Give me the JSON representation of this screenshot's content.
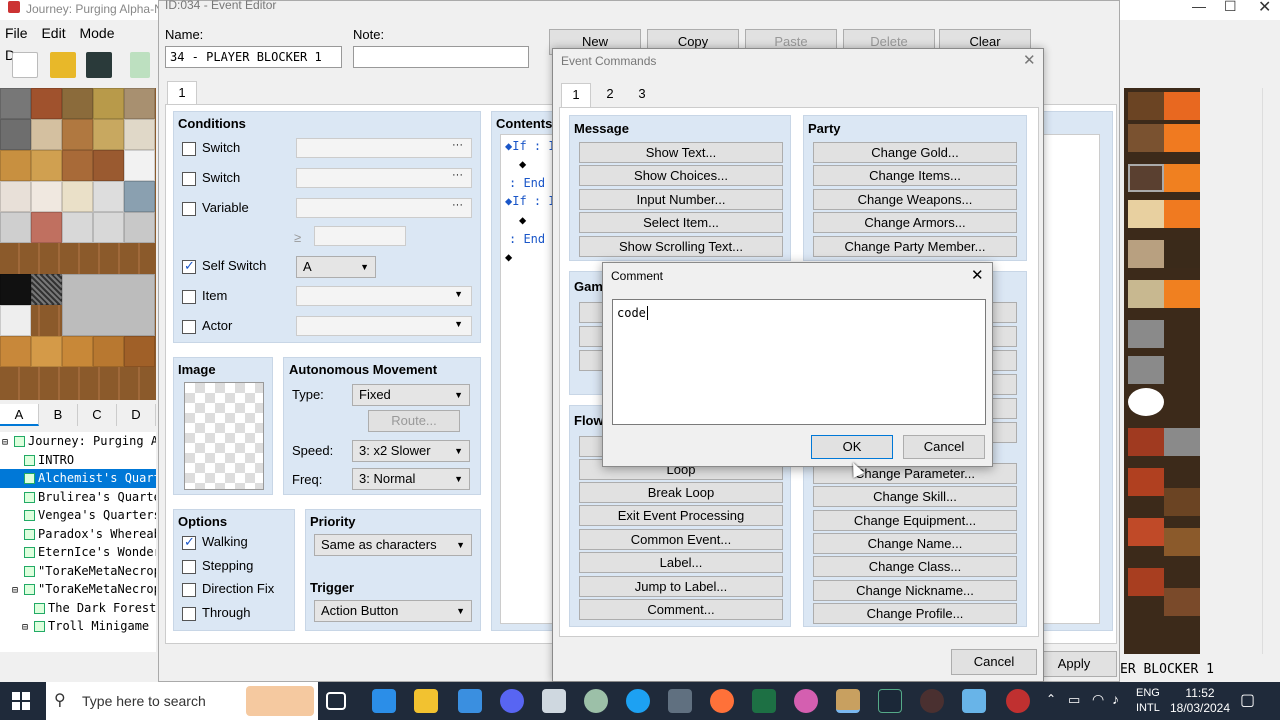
{
  "main": {
    "title": "Journey: Purging Alpha-N",
    "menu": [
      "File",
      "Edit",
      "Mode",
      "Draw"
    ],
    "tile_tabs": [
      "A",
      "B",
      "C",
      "D"
    ],
    "map_tree": [
      {
        "label": "Journey: Purging Al",
        "expand": "⊟",
        "indent": 0,
        "selected": false
      },
      {
        "label": "INTRO",
        "expand": "",
        "indent": 1,
        "selected": false
      },
      {
        "label": "Alchemist's Quarte",
        "expand": "",
        "indent": 1,
        "selected": true
      },
      {
        "label": "Brulirea's Quarter",
        "expand": "",
        "indent": 1,
        "selected": false
      },
      {
        "label": "Vengea's Quarters",
        "expand": "",
        "indent": 1,
        "selected": false
      },
      {
        "label": "Paradox's Whereabo",
        "expand": "",
        "indent": 1,
        "selected": false
      },
      {
        "label": "EternIce's Wonderl",
        "expand": "",
        "indent": 1,
        "selected": false
      },
      {
        "label": "\"ToraKeMetaNecropo",
        "expand": "",
        "indent": 1,
        "selected": false
      },
      {
        "label": "\"ToraKeMetaNecropo",
        "expand": "⊟",
        "indent": 1,
        "selected": false
      },
      {
        "label": "The Dark Forest o",
        "expand": "",
        "indent": 2,
        "selected": false
      },
      {
        "label": "Troll Minigame XE",
        "expand": "⊟",
        "indent": 2,
        "selected": false
      }
    ],
    "map_status": "ER BLOCKER 1"
  },
  "event_editor": {
    "title": "ID:034 - Event Editor",
    "name_label": "Name:",
    "name_value": "34 - PLAYER BLOCKER 1",
    "note_label": "Note:",
    "note_value": "",
    "page_buttons": [
      "New",
      "Copy",
      "Paste",
      "Delete",
      "Clear"
    ],
    "page_tab": "1",
    "conditions": {
      "header": "Conditions",
      "rows": [
        {
          "label": "Switch",
          "checked": false
        },
        {
          "label": "Switch",
          "checked": false
        },
        {
          "label": "Variable",
          "checked": false
        },
        {
          "label": "Self Switch",
          "checked": true
        },
        {
          "label": "Item",
          "checked": false
        },
        {
          "label": "Actor",
          "checked": false
        }
      ],
      "gte_symbol": "≥",
      "self_switch_value": "A"
    },
    "image_header": "Image",
    "autonomous": {
      "header": "Autonomous Movement",
      "type_label": "Type:",
      "type_value": "Fixed",
      "route_label": "Route...",
      "speed_label": "Speed:",
      "speed_value": "3: x2 Slower",
      "freq_label": "Freq:",
      "freq_value": "3: Normal"
    },
    "options": {
      "header": "Options",
      "items": [
        {
          "label": "Walking",
          "checked": true
        },
        {
          "label": "Stepping",
          "checked": false
        },
        {
          "label": "Direction Fix",
          "checked": false
        },
        {
          "label": "Through",
          "checked": false
        }
      ]
    },
    "priority": {
      "header": "Priority",
      "value": "Same as characters"
    },
    "trigger": {
      "header": "Trigger",
      "value": "Action Button"
    },
    "contents": {
      "header": "Contents",
      "lines": [
        "◆If : I",
        "◆",
        ": End",
        "◆If : I",
        "◆",
        ": End",
        "◆"
      ]
    },
    "apply_label": "Apply"
  },
  "event_commands": {
    "title": "Event Commands",
    "tabs": [
      "1",
      "2",
      "3"
    ],
    "message": {
      "header": "Message",
      "buttons": [
        "Show Text...",
        "Show Choices...",
        "Input Number...",
        "Select Item...",
        "Show Scrolling Text..."
      ]
    },
    "party": {
      "header": "Party",
      "buttons": [
        "Change Gold...",
        "Change Items...",
        "Change Weapons...",
        "Change Armors...",
        "Change Party Member..."
      ]
    },
    "game_header": "Gam",
    "flow": {
      "header": "Flow",
      "buttons": [
        "Loop",
        "Break Loop",
        "Exit Event Processing",
        "Common Event...",
        "Label...",
        "Jump to Label...",
        "Comment..."
      ]
    },
    "actor_buttons": [
      "Change Parameter...",
      "Change Skill...",
      "Change Equipment...",
      "Change Name...",
      "Change Class...",
      "Change Nickname...",
      "Change Profile..."
    ],
    "cancel_label": "Cancel"
  },
  "comment_dialog": {
    "title": "Comment",
    "text": "code",
    "ok_label": "OK",
    "cancel_label": "Cancel"
  },
  "taskbar": {
    "search_placeholder": "Type here to search",
    "lang_top": "ENG",
    "lang_bottom": "INTL",
    "time": "11:52",
    "date": "18/03/2024"
  },
  "colors": {
    "accent": "#0078d7",
    "panel": "#dbe7f4",
    "taskbar": "#1f2a3a"
  }
}
